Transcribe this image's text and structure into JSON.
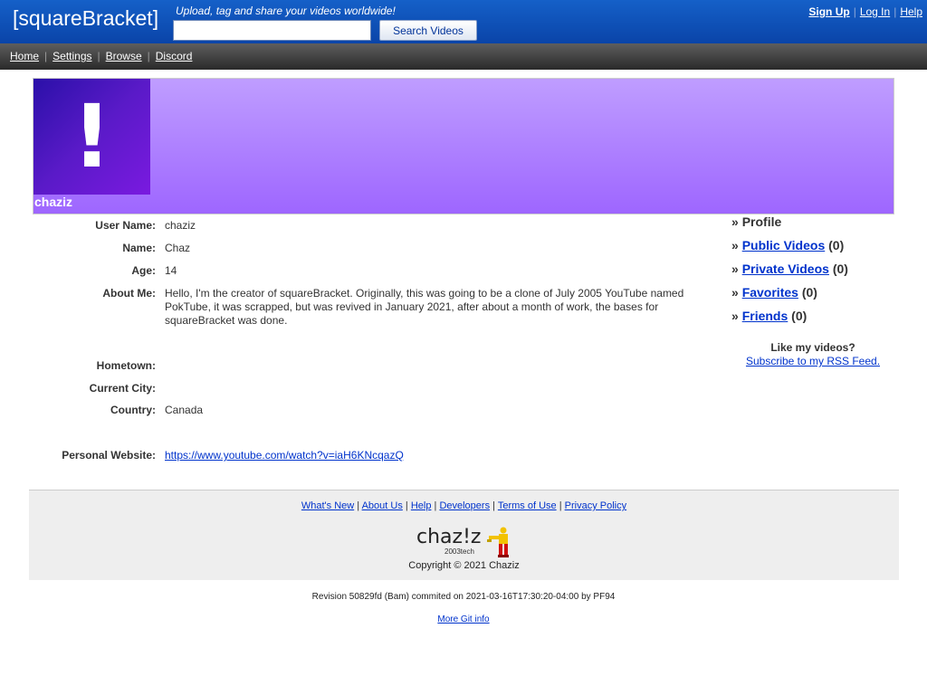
{
  "header": {
    "logo": "[squareBracket]",
    "tagline": "Upload, tag and share your videos worldwide!",
    "search_placeholder": "",
    "search_button": "Search Videos",
    "signup": "Sign Up",
    "login": "Log In",
    "help": "Help",
    "separator": "|"
  },
  "nav": {
    "items": [
      "Home",
      "Settings",
      "Browse",
      "Discord"
    ],
    "separator": "|"
  },
  "banner": {
    "avatar_glyph": "!",
    "name": "chaziz",
    "colors": {
      "top": "#bf9dff",
      "bottom": "#9e66ff"
    }
  },
  "profile": {
    "fields": [
      {
        "label": "User Name:",
        "value": "chaziz"
      },
      {
        "label": "Name:",
        "value": "Chaz"
      },
      {
        "label": "Age:",
        "value": "14"
      },
      {
        "label": "About Me:",
        "value": "Hello, I'm the creator of squareBracket. Originally, this was going to be a clone of July 2005 YouTube named PokTube, it was scrapped, but was revived in January 2021, after about a month of work, the bases for squareBracket was done."
      },
      {
        "label": "Hometown:",
        "value": ""
      },
      {
        "label": "Current City:",
        "value": ""
      },
      {
        "label": "Country:",
        "value": "Canada"
      },
      {
        "label": "Personal Website:",
        "value": "https://www.youtube.com/watch?v=iaH6KNcqazQ"
      }
    ]
  },
  "sidebar": {
    "prefix": "»",
    "profile": "Profile",
    "links": [
      {
        "label": "Public Videos",
        "count": "(0)"
      },
      {
        "label": "Private Videos",
        "count": "(0)"
      },
      {
        "label": "Favorites",
        "count": "(0)"
      },
      {
        "label": "Friends",
        "count": "(0)"
      }
    ],
    "rss_question": "Like my videos?",
    "rss_link": "Subscribe to my RSS Feed."
  },
  "footer": {
    "links": [
      "What's New",
      "About Us",
      "Help",
      "Developers",
      "Terms of Use",
      "Privacy Policy"
    ],
    "separator": "|",
    "logo_text": "chaz!z",
    "logo_sub": "2003tech",
    "copyright": "Copyright © 2021 Chaziz"
  },
  "revision": "Revision 50829fd (Bam) commited on 2021-03-16T17:30:20-04:00 by PF94",
  "git_info": "More Git info"
}
